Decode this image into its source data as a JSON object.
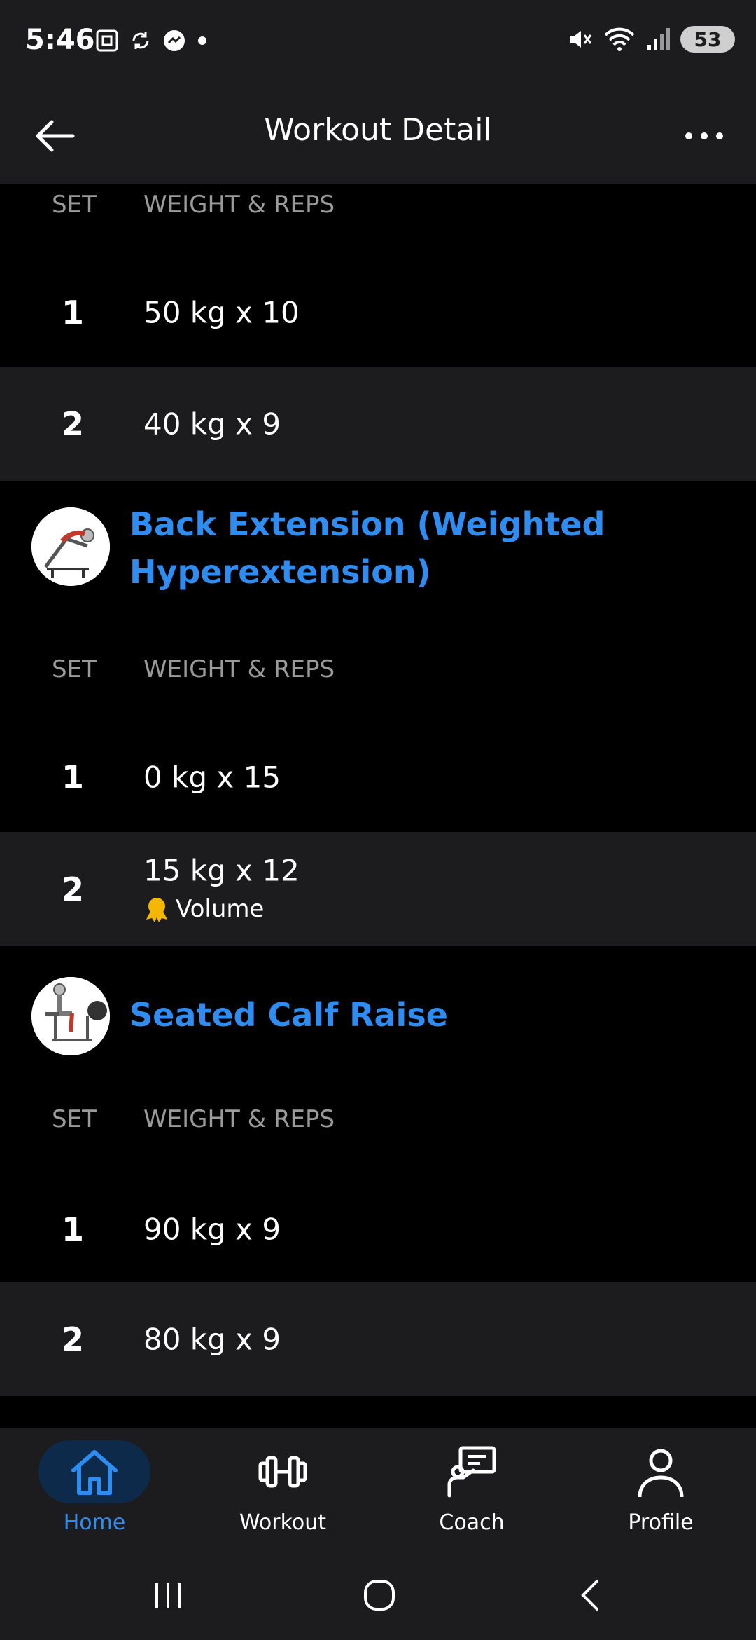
{
  "status": {
    "time": "5:46",
    "battery": "53"
  },
  "header": {
    "title": "Workout Detail"
  },
  "columns": {
    "set": "SET",
    "weight_reps": "WEIGHT & REPS"
  },
  "exercise_prev": {
    "sets": [
      {
        "num": "1",
        "value": "50 kg x 10"
      },
      {
        "num": "2",
        "value": "40 kg x 9"
      }
    ]
  },
  "exercise_back": {
    "title_line1": "Back Extension (Weighted",
    "title_line2": "Hyperextension)",
    "sets": [
      {
        "num": "1",
        "value": "0 kg x 15"
      },
      {
        "num": "2",
        "value": "15 kg x 12",
        "badge": "Volume"
      }
    ]
  },
  "exercise_calf": {
    "title": "Seated Calf Raise",
    "sets": [
      {
        "num": "1",
        "value": "90 kg x 9"
      },
      {
        "num": "2",
        "value": "80 kg x 9"
      }
    ]
  },
  "nav": {
    "home": "Home",
    "workout": "Workout",
    "coach": "Coach",
    "profile": "Profile",
    "active": "home"
  },
  "colors": {
    "accent": "#2f8cf0",
    "surface": "#1c1c1e",
    "background": "#000000",
    "badge": "#f5b800"
  }
}
